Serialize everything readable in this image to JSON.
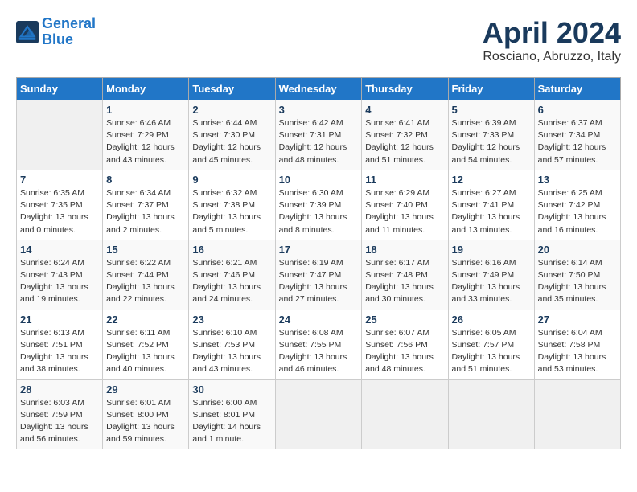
{
  "header": {
    "logo_line1": "General",
    "logo_line2": "Blue",
    "month": "April 2024",
    "location": "Rosciano, Abruzzo, Italy"
  },
  "days_of_week": [
    "Sunday",
    "Monday",
    "Tuesday",
    "Wednesday",
    "Thursday",
    "Friday",
    "Saturday"
  ],
  "weeks": [
    [
      {
        "day": "",
        "info": ""
      },
      {
        "day": "1",
        "info": "Sunrise: 6:46 AM\nSunset: 7:29 PM\nDaylight: 12 hours\nand 43 minutes."
      },
      {
        "day": "2",
        "info": "Sunrise: 6:44 AM\nSunset: 7:30 PM\nDaylight: 12 hours\nand 45 minutes."
      },
      {
        "day": "3",
        "info": "Sunrise: 6:42 AM\nSunset: 7:31 PM\nDaylight: 12 hours\nand 48 minutes."
      },
      {
        "day": "4",
        "info": "Sunrise: 6:41 AM\nSunset: 7:32 PM\nDaylight: 12 hours\nand 51 minutes."
      },
      {
        "day": "5",
        "info": "Sunrise: 6:39 AM\nSunset: 7:33 PM\nDaylight: 12 hours\nand 54 minutes."
      },
      {
        "day": "6",
        "info": "Sunrise: 6:37 AM\nSunset: 7:34 PM\nDaylight: 12 hours\nand 57 minutes."
      }
    ],
    [
      {
        "day": "7",
        "info": "Sunrise: 6:35 AM\nSunset: 7:35 PM\nDaylight: 13 hours\nand 0 minutes."
      },
      {
        "day": "8",
        "info": "Sunrise: 6:34 AM\nSunset: 7:37 PM\nDaylight: 13 hours\nand 2 minutes."
      },
      {
        "day": "9",
        "info": "Sunrise: 6:32 AM\nSunset: 7:38 PM\nDaylight: 13 hours\nand 5 minutes."
      },
      {
        "day": "10",
        "info": "Sunrise: 6:30 AM\nSunset: 7:39 PM\nDaylight: 13 hours\nand 8 minutes."
      },
      {
        "day": "11",
        "info": "Sunrise: 6:29 AM\nSunset: 7:40 PM\nDaylight: 13 hours\nand 11 minutes."
      },
      {
        "day": "12",
        "info": "Sunrise: 6:27 AM\nSunset: 7:41 PM\nDaylight: 13 hours\nand 13 minutes."
      },
      {
        "day": "13",
        "info": "Sunrise: 6:25 AM\nSunset: 7:42 PM\nDaylight: 13 hours\nand 16 minutes."
      }
    ],
    [
      {
        "day": "14",
        "info": "Sunrise: 6:24 AM\nSunset: 7:43 PM\nDaylight: 13 hours\nand 19 minutes."
      },
      {
        "day": "15",
        "info": "Sunrise: 6:22 AM\nSunset: 7:44 PM\nDaylight: 13 hours\nand 22 minutes."
      },
      {
        "day": "16",
        "info": "Sunrise: 6:21 AM\nSunset: 7:46 PM\nDaylight: 13 hours\nand 24 minutes."
      },
      {
        "day": "17",
        "info": "Sunrise: 6:19 AM\nSunset: 7:47 PM\nDaylight: 13 hours\nand 27 minutes."
      },
      {
        "day": "18",
        "info": "Sunrise: 6:17 AM\nSunset: 7:48 PM\nDaylight: 13 hours\nand 30 minutes."
      },
      {
        "day": "19",
        "info": "Sunrise: 6:16 AM\nSunset: 7:49 PM\nDaylight: 13 hours\nand 33 minutes."
      },
      {
        "day": "20",
        "info": "Sunrise: 6:14 AM\nSunset: 7:50 PM\nDaylight: 13 hours\nand 35 minutes."
      }
    ],
    [
      {
        "day": "21",
        "info": "Sunrise: 6:13 AM\nSunset: 7:51 PM\nDaylight: 13 hours\nand 38 minutes."
      },
      {
        "day": "22",
        "info": "Sunrise: 6:11 AM\nSunset: 7:52 PM\nDaylight: 13 hours\nand 40 minutes."
      },
      {
        "day": "23",
        "info": "Sunrise: 6:10 AM\nSunset: 7:53 PM\nDaylight: 13 hours\nand 43 minutes."
      },
      {
        "day": "24",
        "info": "Sunrise: 6:08 AM\nSunset: 7:55 PM\nDaylight: 13 hours\nand 46 minutes."
      },
      {
        "day": "25",
        "info": "Sunrise: 6:07 AM\nSunset: 7:56 PM\nDaylight: 13 hours\nand 48 minutes."
      },
      {
        "day": "26",
        "info": "Sunrise: 6:05 AM\nSunset: 7:57 PM\nDaylight: 13 hours\nand 51 minutes."
      },
      {
        "day": "27",
        "info": "Sunrise: 6:04 AM\nSunset: 7:58 PM\nDaylight: 13 hours\nand 53 minutes."
      }
    ],
    [
      {
        "day": "28",
        "info": "Sunrise: 6:03 AM\nSunset: 7:59 PM\nDaylight: 13 hours\nand 56 minutes."
      },
      {
        "day": "29",
        "info": "Sunrise: 6:01 AM\nSunset: 8:00 PM\nDaylight: 13 hours\nand 59 minutes."
      },
      {
        "day": "30",
        "info": "Sunrise: 6:00 AM\nSunset: 8:01 PM\nDaylight: 14 hours\nand 1 minute."
      },
      {
        "day": "",
        "info": ""
      },
      {
        "day": "",
        "info": ""
      },
      {
        "day": "",
        "info": ""
      },
      {
        "day": "",
        "info": ""
      }
    ]
  ]
}
